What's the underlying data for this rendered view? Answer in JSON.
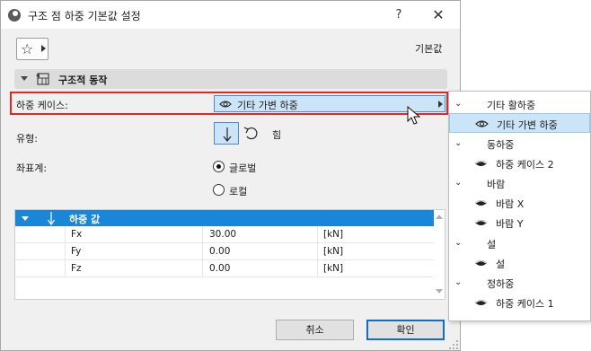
{
  "window": {
    "title": "구조 점 하중 기본값 설정",
    "help_label": "?",
    "close_label": "✕"
  },
  "toolbar": {
    "favorites_icon": "star-icon",
    "default_label": "기본값"
  },
  "section": {
    "label": "구조적 동작"
  },
  "load_case": {
    "label": "하중 케이스:",
    "value": "기타 가변 하중"
  },
  "type": {
    "label": "유형:",
    "moment_label": "힘"
  },
  "coord": {
    "label": "좌표계:",
    "options": [
      {
        "label": "글로벌",
        "selected": true
      },
      {
        "label": "로컬",
        "selected": false
      }
    ]
  },
  "table": {
    "header": "하중 값",
    "rows": [
      {
        "name": "Fx",
        "value": "30.00",
        "unit": "[kN]"
      },
      {
        "name": "Fy",
        "value": "0.00",
        "unit": "[kN]"
      },
      {
        "name": "Fz",
        "value": "0.00",
        "unit": "[kN]"
      }
    ]
  },
  "buttons": {
    "cancel": "취소",
    "ok": "확인"
  },
  "popup": {
    "groups": [
      {
        "label": "기타 활하중",
        "items": [
          {
            "label": "기타 가변 하중",
            "selected": true
          }
        ]
      },
      {
        "label": "동하중",
        "items": [
          {
            "label": "하중 케이스 2",
            "selected": false
          }
        ]
      },
      {
        "label": "바람",
        "items": [
          {
            "label": "바람 X",
            "selected": false
          },
          {
            "label": "바람 Y",
            "selected": false
          }
        ]
      },
      {
        "label": "설",
        "items": [
          {
            "label": "설",
            "selected": false
          }
        ]
      },
      {
        "label": "정하중",
        "items": [
          {
            "label": "하중 케이스 1",
            "selected": false
          }
        ]
      }
    ]
  },
  "colors": {
    "accent": "#1a86d8",
    "selection": "#cce4f7",
    "highlight_box": "#e8261f"
  }
}
